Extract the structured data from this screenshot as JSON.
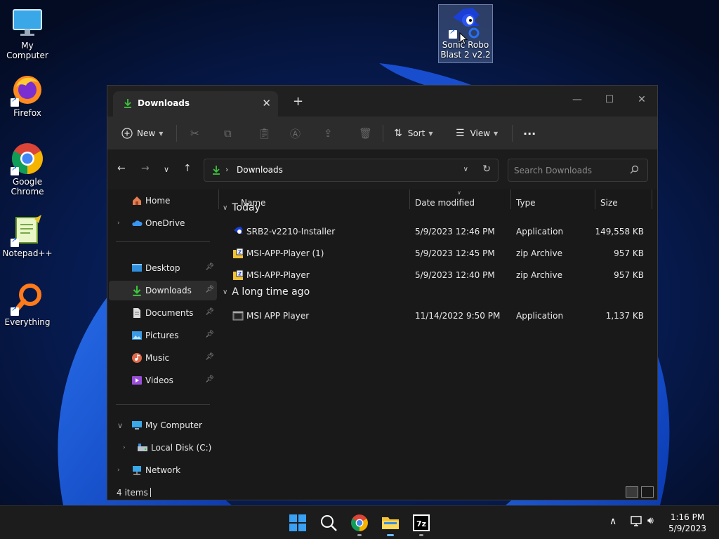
{
  "colors": {
    "accent": "#0078d4",
    "download_green": "#3ec43e",
    "window_bg": "#191919",
    "toolbar_bg": "#2c2c2c",
    "taskbar_bg": "#1c1c1c"
  },
  "desktop": {
    "icons": [
      {
        "label": "My Computer",
        "icon": "monitor-icon"
      },
      {
        "label": "Firefox",
        "icon": "firefox-icon"
      },
      {
        "label": "Google\nChrome",
        "icon": "chrome-icon"
      },
      {
        "label": "Notepad++",
        "icon": "notepadpp-icon"
      },
      {
        "label": "Everything",
        "icon": "everything-search-icon"
      },
      {
        "label": "Sonic Robo\nBlast 2 v2.2",
        "icon": "sonic-icon"
      }
    ]
  },
  "window": {
    "tab_title": "Downloads",
    "new_tab": "+",
    "controls": {
      "minimize": "—",
      "maximize": "☐",
      "close": "✕"
    },
    "toolbar": {
      "new_label": "New",
      "sort_label": "Sort",
      "view_label": "View",
      "more_label": "···"
    },
    "address": {
      "path": "Downloads"
    },
    "search": {
      "placeholder": "Search Downloads"
    },
    "sidebar": {
      "home": "Home",
      "onedrive": "OneDrive",
      "desktop": "Desktop",
      "downloads": "Downloads",
      "documents": "Documents",
      "pictures": "Pictures",
      "music": "Music",
      "videos": "Videos",
      "my_computer": "My Computer",
      "local_disk": "Local Disk (C:)",
      "network": "Network"
    },
    "columns": {
      "name": "Name",
      "date": "Date modified",
      "type": "Type",
      "size": "Size"
    },
    "groups": [
      {
        "label": "Today",
        "files": [
          {
            "name": "SRB2-v2210-Installer",
            "date": "5/9/2023 12:46 PM",
            "type": "Application",
            "size": "149,558 KB",
            "icon": "sonic-app-icon"
          },
          {
            "name": "MSI-APP-Player (1)",
            "date": "5/9/2023 12:45 PM",
            "type": "zip Archive",
            "size": "957 KB",
            "icon": "zip-archive-icon"
          },
          {
            "name": "MSI-APP-Player",
            "date": "5/9/2023 12:40 PM",
            "type": "zip Archive",
            "size": "957 KB",
            "icon": "zip-archive-icon"
          }
        ]
      },
      {
        "label": "A long time ago",
        "files": [
          {
            "name": "MSI APP Player",
            "date": "11/14/2022 9:50 PM",
            "type": "Application",
            "size": "1,137 KB",
            "icon": "application-icon"
          }
        ]
      }
    ],
    "status": {
      "items": "4 items"
    }
  },
  "taskbar": {
    "time": "1:16 PM",
    "date": "5/9/2023"
  }
}
